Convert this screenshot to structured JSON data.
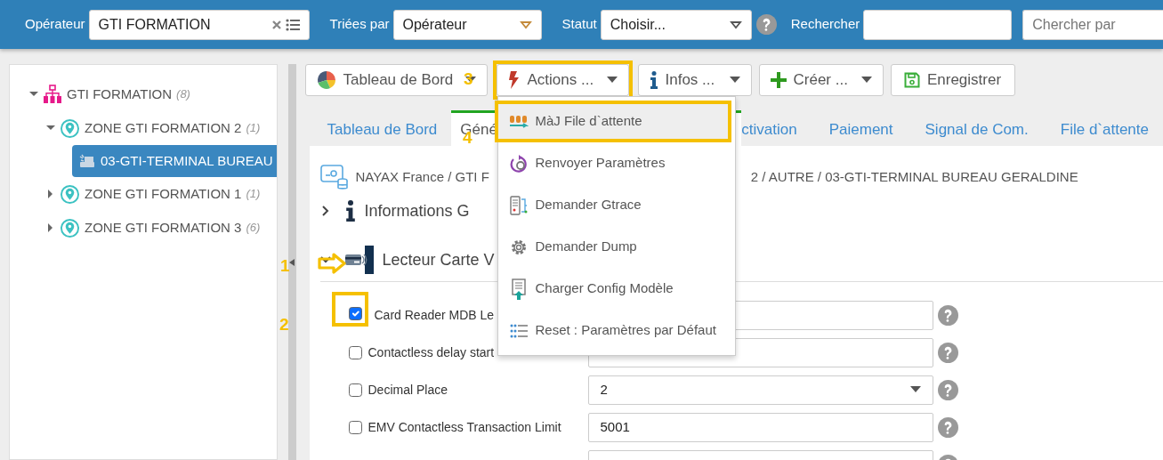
{
  "navbar": {
    "operator": {
      "label": "Opérateur",
      "value": "GTI FORMATION"
    },
    "sort": {
      "label": "Triées par",
      "value": "Opérateur"
    },
    "status": {
      "label": "Statut",
      "value": "Choisir..."
    },
    "search": {
      "label": "Rechercher"
    },
    "search_by": {
      "placeholder": "Chercher par"
    }
  },
  "tree": [
    {
      "label": "GTI FORMATION",
      "count": "(8)",
      "kind": "org",
      "expanded": true,
      "selected": false,
      "children": [
        {
          "label": "ZONE GTI FORMATION 2",
          "count": "(1)",
          "kind": "zone",
          "expanded": true,
          "selected": false,
          "children": [
            {
              "label": "03-GTI-TERMINAL BUREAU",
              "kind": "terminal",
              "selected": true
            }
          ]
        },
        {
          "label": "ZONE GTI FORMATION 1",
          "count": "(1)",
          "kind": "zone",
          "expanded": false,
          "selected": false
        },
        {
          "label": "ZONE GTI FORMATION 3",
          "count": "(6)",
          "kind": "zone",
          "expanded": false,
          "selected": false
        }
      ]
    }
  ],
  "toolbar": [
    {
      "label": "Tableau de Bord",
      "kind": "pie",
      "caret": true
    },
    {
      "label": "Actions ...",
      "kind": "bolt",
      "caret": true
    },
    {
      "label": "Infos ...",
      "kind": "info",
      "caret": true
    },
    {
      "label": "Créer ...",
      "kind": "plus",
      "caret": true
    },
    {
      "label": "Enregistrer",
      "kind": "save",
      "caret": false
    }
  ],
  "tabs": [
    {
      "label": "Tableau de Bord",
      "selected": false
    },
    {
      "label": "Géné",
      "selected": true
    },
    {
      "label": "ctivation",
      "selected": false
    },
    {
      "label": "Paiement",
      "selected": false
    },
    {
      "label": "Signal de Com.",
      "selected": false
    },
    {
      "label": "File d`attente",
      "selected": false
    }
  ],
  "breadcrumb": [
    "NAYAX France / GTI F",
    "2 / AUTRE / 03-GTI-TERMINAL BUREAU GERALDINE"
  ],
  "sections": [
    {
      "title": "Informations G",
      "kind": "info",
      "expanded": false
    },
    {
      "title": "Lecteur Carte V",
      "kind": "card",
      "expanded": true
    }
  ],
  "fields": [
    {
      "label": "Card Reader MDB Le",
      "kind": "text",
      "checked": true
    },
    {
      "label": "Contactless delay start",
      "kind": "text",
      "checked": false
    },
    {
      "label": "Decimal Place",
      "kind": "select",
      "checked": false,
      "value": "2"
    },
    {
      "label": "EMV Contactless Transaction Limit",
      "kind": "text",
      "checked": false,
      "value": "5001"
    },
    {
      "kind": "text"
    }
  ],
  "menu": [
    {
      "label": "MàJ File d`attente",
      "kind": "queue",
      "selected": true
    },
    {
      "label": "Renvoyer Paramètres",
      "kind": "resend",
      "selected": false
    },
    {
      "label": "Demander Gtrace",
      "kind": "trace",
      "selected": false
    },
    {
      "label": "Demander Dump",
      "kind": "gear",
      "selected": false
    },
    {
      "label": "Charger Config Modèle",
      "kind": "upload",
      "selected": false
    },
    {
      "label": "Reset : Paramètres par Défaut",
      "kind": "list",
      "selected": false
    }
  ],
  "annotations": [
    "1",
    "2",
    "3",
    "4"
  ]
}
